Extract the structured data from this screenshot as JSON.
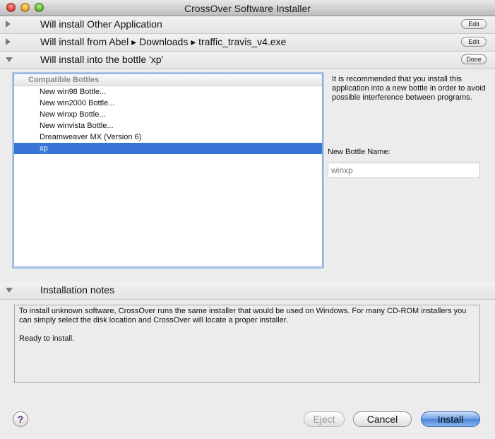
{
  "window": {
    "title": "CrossOver Software Installer"
  },
  "sections": {
    "app": {
      "label": "Will install Other Application",
      "button": "Edit"
    },
    "source": {
      "label": "Will install from Abel ▸ Downloads ▸ traffic_travis_v4.exe",
      "button": "Edit"
    },
    "bottle": {
      "label": "Will install into the bottle 'xp'",
      "button": "Done"
    },
    "notes": {
      "label": "Installation notes"
    }
  },
  "bottles": {
    "header": "Compatible Bottles",
    "items": [
      {
        "label": "New win98 Bottle..."
      },
      {
        "label": "New win2000 Bottle..."
      },
      {
        "label": "New winxp Bottle..."
      },
      {
        "label": "New winvista Bottle..."
      },
      {
        "label": "Dreamweaver MX (Version 6)"
      },
      {
        "label": "xp"
      }
    ],
    "selected": "xp"
  },
  "recommendation": "It is recommended that you install this application into a new bottle in order to avoid possible interference between programs.",
  "new_bottle": {
    "label": "New Bottle Name:",
    "placeholder": "winxp"
  },
  "install_notes": {
    "line1": "To install unknown software, CrossOver runs the same installer that would be used on Windows. For many CD-ROM installers you can simply select the disk location and CrossOver will locate a proper installer.",
    "line2": "Ready to install."
  },
  "buttons": {
    "help": "?",
    "eject": "Eject",
    "cancel": "Cancel",
    "install": "Install"
  },
  "colors": {
    "selection": "#3875d7",
    "default_button": "#4a84d8"
  }
}
